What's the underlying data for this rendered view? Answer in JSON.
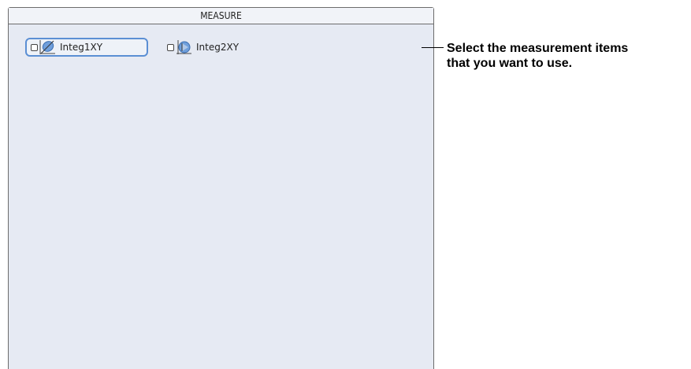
{
  "panel": {
    "title": "MEASURE",
    "items": [
      {
        "label": "Integ1XY",
        "checked": false,
        "selected": true,
        "icon": "integ1xy-icon"
      },
      {
        "label": "Integ2XY",
        "checked": false,
        "selected": false,
        "icon": "integ2xy-icon"
      }
    ]
  },
  "callout": {
    "line1": "Select the measurement items",
    "line2": "that you want to use."
  },
  "colors": {
    "panel_bg": "#e6eaf3",
    "selection_border": "#5b8fd4",
    "icon_blue": "#4f83c8"
  }
}
